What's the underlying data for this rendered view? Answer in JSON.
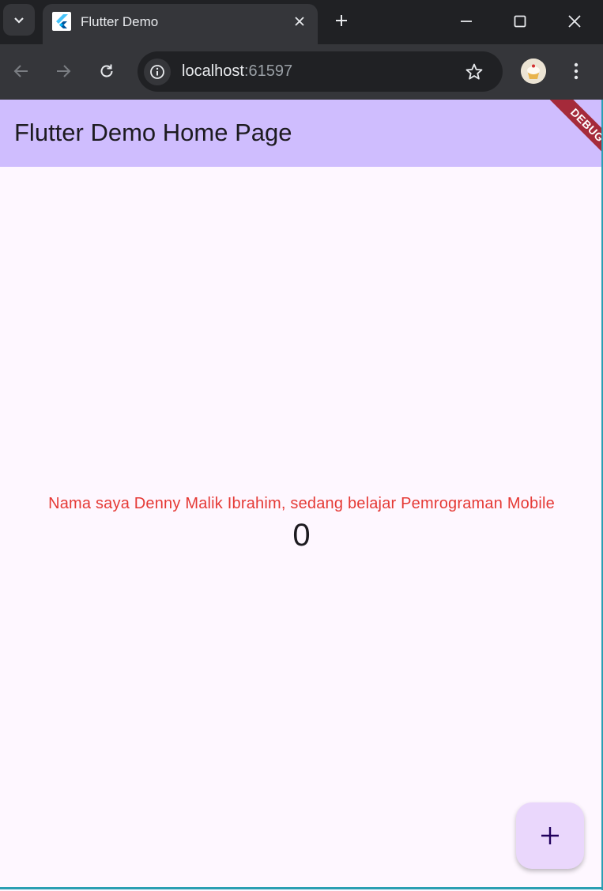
{
  "browser": {
    "tab": {
      "title": "Flutter Demo"
    },
    "address": {
      "host": "localhost",
      "port": ":61597"
    }
  },
  "app": {
    "title": "Flutter Demo Home Page",
    "debug_banner": "DEBUG",
    "message": "Nama saya Denny Malik Ibrahim, sedang belajar Pemrograman Mobile",
    "counter": "0",
    "colors": {
      "appbar": "#cfbdfe",
      "background": "#fef7ff",
      "message": "#e53935",
      "fab": "#ead7fc"
    }
  },
  "icons": {
    "tab_search": "chevron-down-icon",
    "favicon": "flutter-logo-icon",
    "close": "close-icon",
    "new_tab": "plus-icon",
    "back": "arrow-left-icon",
    "forward": "arrow-right-icon",
    "reload": "reload-icon",
    "site_info": "info-icon",
    "bookmark": "star-icon",
    "menu": "more-vert-icon",
    "fab": "plus-icon"
  }
}
